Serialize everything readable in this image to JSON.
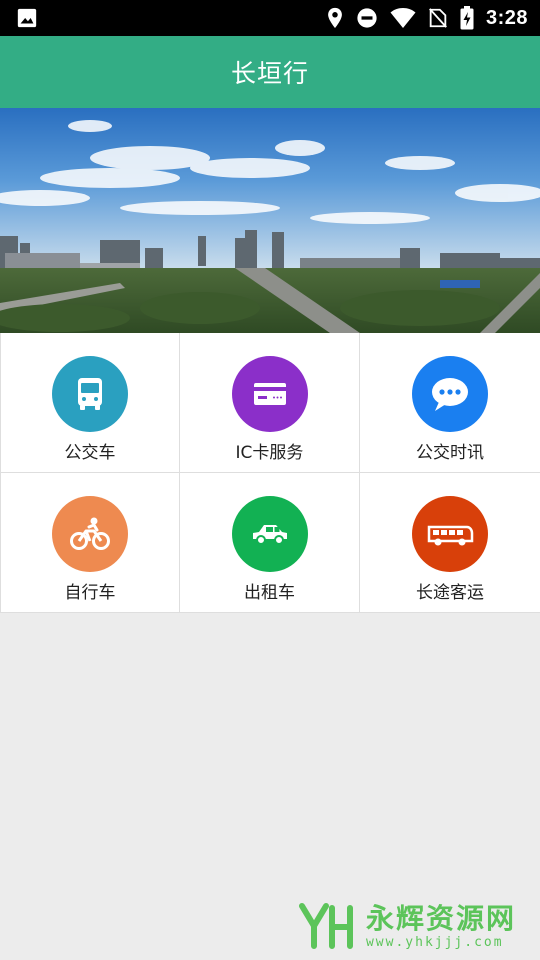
{
  "status_bar": {
    "time": "3:28",
    "icons": [
      "image-notification-icon",
      "location-icon",
      "do-not-disturb-icon",
      "wifi-icon",
      "no-sim-icon",
      "battery-charging-icon"
    ]
  },
  "app_bar": {
    "title": "长垣行"
  },
  "banner": {
    "description_icon": "city-panorama-banner"
  },
  "services": [
    {
      "label": "公交车",
      "icon": "bus-icon",
      "color": "#2aa0c0"
    },
    {
      "label": "IC卡服务",
      "icon": "card-icon",
      "color": "#8b2fc9"
    },
    {
      "label": "公交时讯",
      "icon": "chat-bubble-icon",
      "color": "#1a7ff0"
    },
    {
      "label": "自行车",
      "icon": "bicycle-icon",
      "color": "#ee8a50"
    },
    {
      "label": "出租车",
      "icon": "taxi-icon",
      "color": "#12b153"
    },
    {
      "label": "长途客运",
      "icon": "coach-bus-icon",
      "color": "#d8400a"
    }
  ],
  "watermark": {
    "name": "永辉资源网",
    "url": "www.yhkjjj.com",
    "logo_text": "YH",
    "color": "#5cc45a"
  }
}
